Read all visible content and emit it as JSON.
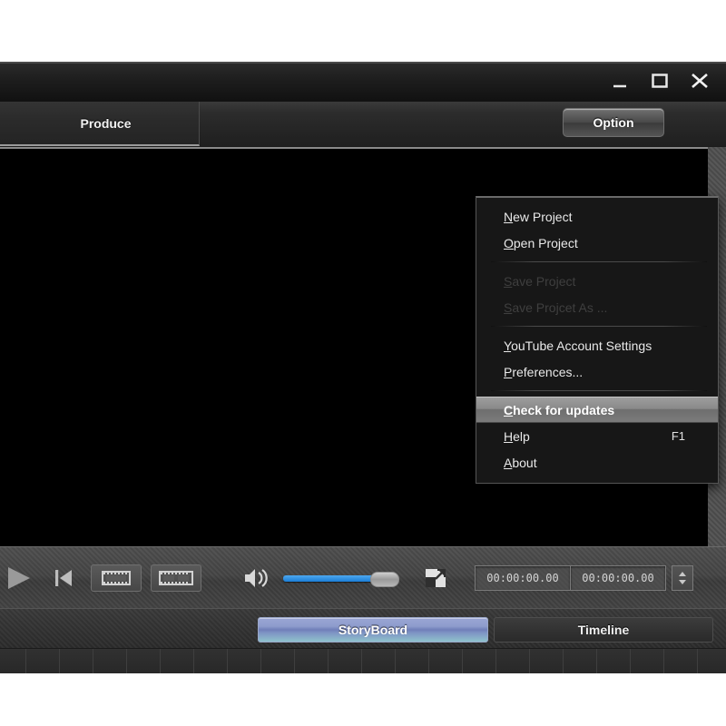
{
  "window": {
    "controls": [
      {
        "name": "minimize-button",
        "label": "Minimize"
      },
      {
        "name": "maximize-button",
        "label": "Maximize"
      },
      {
        "name": "close-button",
        "label": "Close"
      }
    ]
  },
  "toolbar": {
    "produce_tab_label": "Produce",
    "option_button_label": "Option"
  },
  "option_menu": {
    "items": [
      {
        "mnemonic": "N",
        "rest": "ew Project",
        "state": "normal",
        "shortcut": ""
      },
      {
        "mnemonic": "O",
        "rest": "pen Project",
        "state": "normal",
        "shortcut": ""
      },
      {
        "separator": true
      },
      {
        "mnemonic": "S",
        "rest": "ave Project",
        "state": "disabled",
        "shortcut": ""
      },
      {
        "mnemonic": "S",
        "rest": "ave Projcet As ...",
        "state": "disabled",
        "shortcut": ""
      },
      {
        "separator": true
      },
      {
        "mnemonic": "Y",
        "rest": "ouTube Account Settings",
        "state": "normal",
        "shortcut": ""
      },
      {
        "mnemonic": "P",
        "rest": "references...",
        "state": "normal",
        "shortcut": ""
      },
      {
        "separator": true
      },
      {
        "mnemonic": "C",
        "rest": "heck for updates",
        "state": "highlighted",
        "shortcut": ""
      },
      {
        "mnemonic": "H",
        "rest": "elp",
        "state": "normal",
        "shortcut": "F1"
      },
      {
        "mnemonic": "A",
        "rest": "bout",
        "state": "normal",
        "shortcut": ""
      }
    ]
  },
  "transport": {
    "play_label": "Play",
    "prev_label": "Previous Frame",
    "snapshot_label": "Capture Frame",
    "snapshot_range_label": "Capture Range",
    "speaker_label": "Mute",
    "volume_label": "Volume",
    "volume_percent": 88,
    "fullscreen_label": "Fullscreen",
    "timecode_current": "00:00:00.00",
    "timecode_total": "00:00:00.00"
  },
  "tabs": {
    "storyboard_label": "StoryBoard",
    "timeline_label": "Timeline",
    "active": "StoryBoard"
  },
  "storyboard": {
    "cell_count": 23
  },
  "colors": {
    "accent_blue": "#1b7ed6",
    "tab_active": "#8e9ccd",
    "window_bg": "#1b1b1b",
    "video_bg": "#000000",
    "menu_bg": "#171717",
    "highlight": "#8a8a8a"
  }
}
